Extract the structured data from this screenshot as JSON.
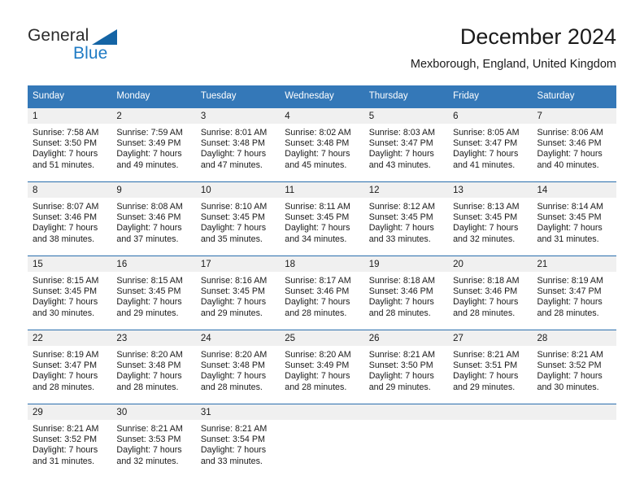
{
  "brand": {
    "name_part1": "General",
    "name_part2": "Blue",
    "triangle_color": "#1464a5",
    "blue_color": "#1f7bc4"
  },
  "header": {
    "title": "December 2024",
    "subtitle": "Mexborough, England, United Kingdom"
  },
  "theme": {
    "header_background": "#3478b8",
    "row_separator": "#2a6ead",
    "daynum_background": "#f0f0f0"
  },
  "calendar": {
    "weekday_headers": [
      "Sunday",
      "Monday",
      "Tuesday",
      "Wednesday",
      "Thursday",
      "Friday",
      "Saturday"
    ],
    "weeks": [
      [
        {
          "day": "1",
          "sunrise": "Sunrise: 7:58 AM",
          "sunset": "Sunset: 3:50 PM",
          "daylight_line1": "Daylight: 7 hours",
          "daylight_line2": "and 51 minutes."
        },
        {
          "day": "2",
          "sunrise": "Sunrise: 7:59 AM",
          "sunset": "Sunset: 3:49 PM",
          "daylight_line1": "Daylight: 7 hours",
          "daylight_line2": "and 49 minutes."
        },
        {
          "day": "3",
          "sunrise": "Sunrise: 8:01 AM",
          "sunset": "Sunset: 3:48 PM",
          "daylight_line1": "Daylight: 7 hours",
          "daylight_line2": "and 47 minutes."
        },
        {
          "day": "4",
          "sunrise": "Sunrise: 8:02 AM",
          "sunset": "Sunset: 3:48 PM",
          "daylight_line1": "Daylight: 7 hours",
          "daylight_line2": "and 45 minutes."
        },
        {
          "day": "5",
          "sunrise": "Sunrise: 8:03 AM",
          "sunset": "Sunset: 3:47 PM",
          "daylight_line1": "Daylight: 7 hours",
          "daylight_line2": "and 43 minutes."
        },
        {
          "day": "6",
          "sunrise": "Sunrise: 8:05 AM",
          "sunset": "Sunset: 3:47 PM",
          "daylight_line1": "Daylight: 7 hours",
          "daylight_line2": "and 41 minutes."
        },
        {
          "day": "7",
          "sunrise": "Sunrise: 8:06 AM",
          "sunset": "Sunset: 3:46 PM",
          "daylight_line1": "Daylight: 7 hours",
          "daylight_line2": "and 40 minutes."
        }
      ],
      [
        {
          "day": "8",
          "sunrise": "Sunrise: 8:07 AM",
          "sunset": "Sunset: 3:46 PM",
          "daylight_line1": "Daylight: 7 hours",
          "daylight_line2": "and 38 minutes."
        },
        {
          "day": "9",
          "sunrise": "Sunrise: 8:08 AM",
          "sunset": "Sunset: 3:46 PM",
          "daylight_line1": "Daylight: 7 hours",
          "daylight_line2": "and 37 minutes."
        },
        {
          "day": "10",
          "sunrise": "Sunrise: 8:10 AM",
          "sunset": "Sunset: 3:45 PM",
          "daylight_line1": "Daylight: 7 hours",
          "daylight_line2": "and 35 minutes."
        },
        {
          "day": "11",
          "sunrise": "Sunrise: 8:11 AM",
          "sunset": "Sunset: 3:45 PM",
          "daylight_line1": "Daylight: 7 hours",
          "daylight_line2": "and 34 minutes."
        },
        {
          "day": "12",
          "sunrise": "Sunrise: 8:12 AM",
          "sunset": "Sunset: 3:45 PM",
          "daylight_line1": "Daylight: 7 hours",
          "daylight_line2": "and 33 minutes."
        },
        {
          "day": "13",
          "sunrise": "Sunrise: 8:13 AM",
          "sunset": "Sunset: 3:45 PM",
          "daylight_line1": "Daylight: 7 hours",
          "daylight_line2": "and 32 minutes."
        },
        {
          "day": "14",
          "sunrise": "Sunrise: 8:14 AM",
          "sunset": "Sunset: 3:45 PM",
          "daylight_line1": "Daylight: 7 hours",
          "daylight_line2": "and 31 minutes."
        }
      ],
      [
        {
          "day": "15",
          "sunrise": "Sunrise: 8:15 AM",
          "sunset": "Sunset: 3:45 PM",
          "daylight_line1": "Daylight: 7 hours",
          "daylight_line2": "and 30 minutes."
        },
        {
          "day": "16",
          "sunrise": "Sunrise: 8:15 AM",
          "sunset": "Sunset: 3:45 PM",
          "daylight_line1": "Daylight: 7 hours",
          "daylight_line2": "and 29 minutes."
        },
        {
          "day": "17",
          "sunrise": "Sunrise: 8:16 AM",
          "sunset": "Sunset: 3:45 PM",
          "daylight_line1": "Daylight: 7 hours",
          "daylight_line2": "and 29 minutes."
        },
        {
          "day": "18",
          "sunrise": "Sunrise: 8:17 AM",
          "sunset": "Sunset: 3:46 PM",
          "daylight_line1": "Daylight: 7 hours",
          "daylight_line2": "and 28 minutes."
        },
        {
          "day": "19",
          "sunrise": "Sunrise: 8:18 AM",
          "sunset": "Sunset: 3:46 PM",
          "daylight_line1": "Daylight: 7 hours",
          "daylight_line2": "and 28 minutes."
        },
        {
          "day": "20",
          "sunrise": "Sunrise: 8:18 AM",
          "sunset": "Sunset: 3:46 PM",
          "daylight_line1": "Daylight: 7 hours",
          "daylight_line2": "and 28 minutes."
        },
        {
          "day": "21",
          "sunrise": "Sunrise: 8:19 AM",
          "sunset": "Sunset: 3:47 PM",
          "daylight_line1": "Daylight: 7 hours",
          "daylight_line2": "and 28 minutes."
        }
      ],
      [
        {
          "day": "22",
          "sunrise": "Sunrise: 8:19 AM",
          "sunset": "Sunset: 3:47 PM",
          "daylight_line1": "Daylight: 7 hours",
          "daylight_line2": "and 28 minutes."
        },
        {
          "day": "23",
          "sunrise": "Sunrise: 8:20 AM",
          "sunset": "Sunset: 3:48 PM",
          "daylight_line1": "Daylight: 7 hours",
          "daylight_line2": "and 28 minutes."
        },
        {
          "day": "24",
          "sunrise": "Sunrise: 8:20 AM",
          "sunset": "Sunset: 3:48 PM",
          "daylight_line1": "Daylight: 7 hours",
          "daylight_line2": "and 28 minutes."
        },
        {
          "day": "25",
          "sunrise": "Sunrise: 8:20 AM",
          "sunset": "Sunset: 3:49 PM",
          "daylight_line1": "Daylight: 7 hours",
          "daylight_line2": "and 28 minutes."
        },
        {
          "day": "26",
          "sunrise": "Sunrise: 8:21 AM",
          "sunset": "Sunset: 3:50 PM",
          "daylight_line1": "Daylight: 7 hours",
          "daylight_line2": "and 29 minutes."
        },
        {
          "day": "27",
          "sunrise": "Sunrise: 8:21 AM",
          "sunset": "Sunset: 3:51 PM",
          "daylight_line1": "Daylight: 7 hours",
          "daylight_line2": "and 29 minutes."
        },
        {
          "day": "28",
          "sunrise": "Sunrise: 8:21 AM",
          "sunset": "Sunset: 3:52 PM",
          "daylight_line1": "Daylight: 7 hours",
          "daylight_line2": "and 30 minutes."
        }
      ],
      [
        {
          "day": "29",
          "sunrise": "Sunrise: 8:21 AM",
          "sunset": "Sunset: 3:52 PM",
          "daylight_line1": "Daylight: 7 hours",
          "daylight_line2": "and 31 minutes."
        },
        {
          "day": "30",
          "sunrise": "Sunrise: 8:21 AM",
          "sunset": "Sunset: 3:53 PM",
          "daylight_line1": "Daylight: 7 hours",
          "daylight_line2": "and 32 minutes."
        },
        {
          "day": "31",
          "sunrise": "Sunrise: 8:21 AM",
          "sunset": "Sunset: 3:54 PM",
          "daylight_line1": "Daylight: 7 hours",
          "daylight_line2": "and 33 minutes."
        },
        {
          "day": "",
          "sunrise": "",
          "sunset": "",
          "daylight_line1": "",
          "daylight_line2": ""
        },
        {
          "day": "",
          "sunrise": "",
          "sunset": "",
          "daylight_line1": "",
          "daylight_line2": ""
        },
        {
          "day": "",
          "sunrise": "",
          "sunset": "",
          "daylight_line1": "",
          "daylight_line2": ""
        },
        {
          "day": "",
          "sunrise": "",
          "sunset": "",
          "daylight_line1": "",
          "daylight_line2": ""
        }
      ]
    ]
  }
}
